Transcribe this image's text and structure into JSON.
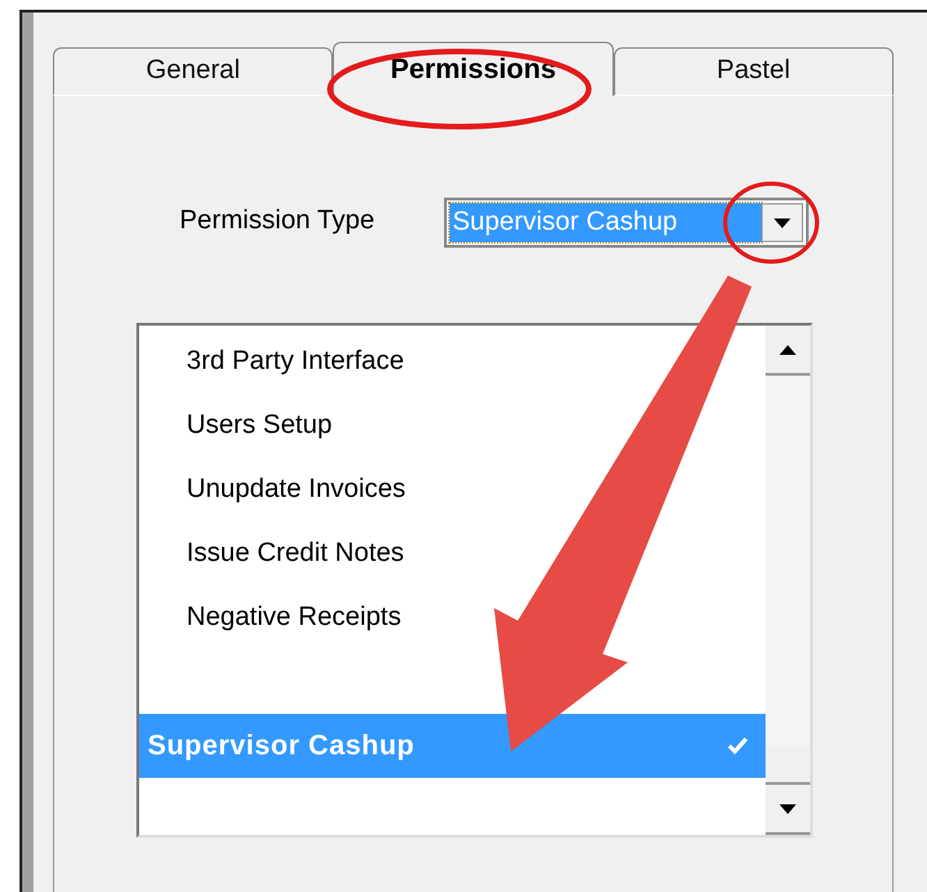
{
  "tabs": [
    {
      "label": "General",
      "selected": false
    },
    {
      "label": "Permissions",
      "selected": true
    },
    {
      "label": "Pastel",
      "selected": false
    }
  ],
  "permission_type": {
    "label": "Permission Type",
    "value": "Supervisor Cashup",
    "selected": true
  },
  "list": [
    {
      "kind": "item",
      "label": "3rd Party Interface",
      "selected": false,
      "checked": false
    },
    {
      "kind": "item",
      "label": "Users Setup",
      "selected": false,
      "checked": false
    },
    {
      "kind": "item",
      "label": "Unupdate Invoices",
      "selected": false,
      "checked": false
    },
    {
      "kind": "item",
      "label": "Issue Credit Notes",
      "selected": false,
      "checked": false
    },
    {
      "kind": "item",
      "label": "Negative Receipts",
      "selected": false,
      "checked": false
    },
    {
      "kind": "blank"
    },
    {
      "kind": "item",
      "label": "Supervisor Cashup",
      "selected": true,
      "checked": true
    }
  ]
}
